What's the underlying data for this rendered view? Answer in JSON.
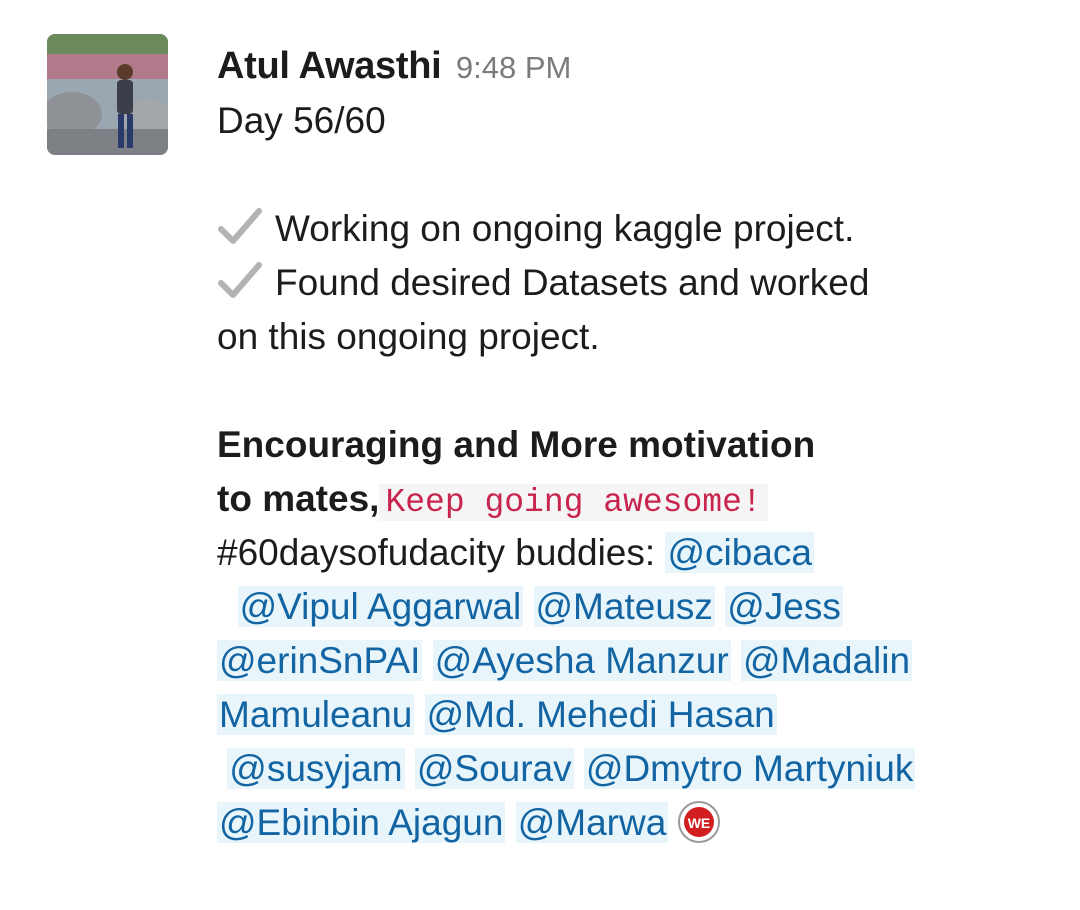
{
  "message": {
    "sender": "Atul Awasthi",
    "timestamp": "9:48 PM",
    "avatar_icon": "user-photo-avatar",
    "day_progress": "Day 56/60",
    "checklist": [
      {
        "icon": "check-mark-icon",
        "text": "Working on ongoing kaggle project."
      },
      {
        "icon": "check-mark-icon",
        "text": "Found desired Datasets and worked"
      }
    ],
    "checklist_continuation": "on this ongoing project.",
    "motivation_bold_1": "Encouraging and More motivation",
    "motivation_bold_2": "to mates,",
    "code_text": "Keep going awesome!",
    "hashtag_text": "#60daysofudacity buddies: ",
    "mentions": [
      "@cibaca",
      "@Vipul Aggarwal",
      "@Mateusz",
      "@Jess",
      "@erinSnPAI",
      "@Ayesha Manzur",
      "@Madalin",
      "Mamuleanu",
      "@Md. Mehedi Hasan",
      "@susyjam",
      "@Sourav",
      "@Dmytro Martyniuk",
      "@Ebinbin Ajagun",
      "@Marwa"
    ],
    "badge_icon": "we-emoji-icon",
    "badge_text": "WE",
    "colors": {
      "mention_text": "#1264a3",
      "mention_bg": "#e8f5fa",
      "code_text": "#c7254e",
      "timestamp": "#7b7b7b"
    }
  }
}
